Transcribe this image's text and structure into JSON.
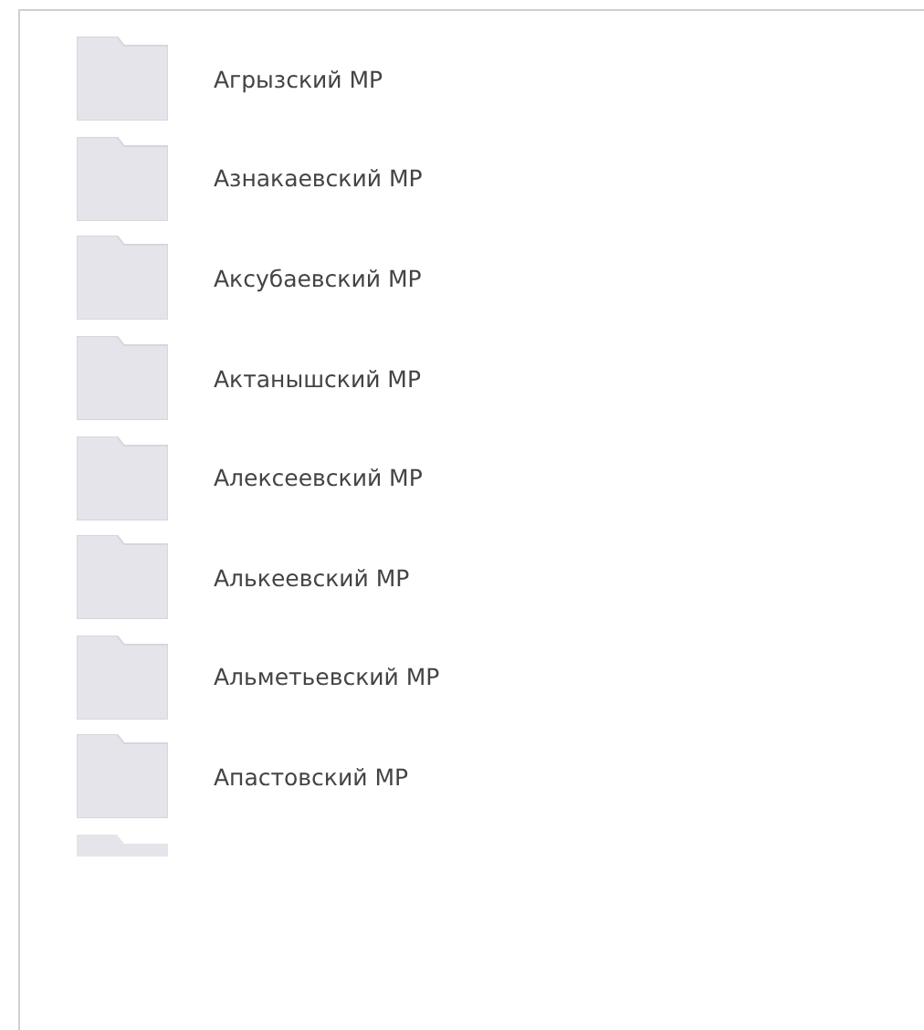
{
  "folders": [
    {
      "name": "Агрызский МР"
    },
    {
      "name": "Азнакаевский МР"
    },
    {
      "name": "Аксубаевский МР"
    },
    {
      "name": "Актанышский МР"
    },
    {
      "name": "Алексеевский МР"
    },
    {
      "name": "Алькеевский МР"
    },
    {
      "name": "Альметьевский МР"
    },
    {
      "name": "Апастовский МР"
    }
  ]
}
